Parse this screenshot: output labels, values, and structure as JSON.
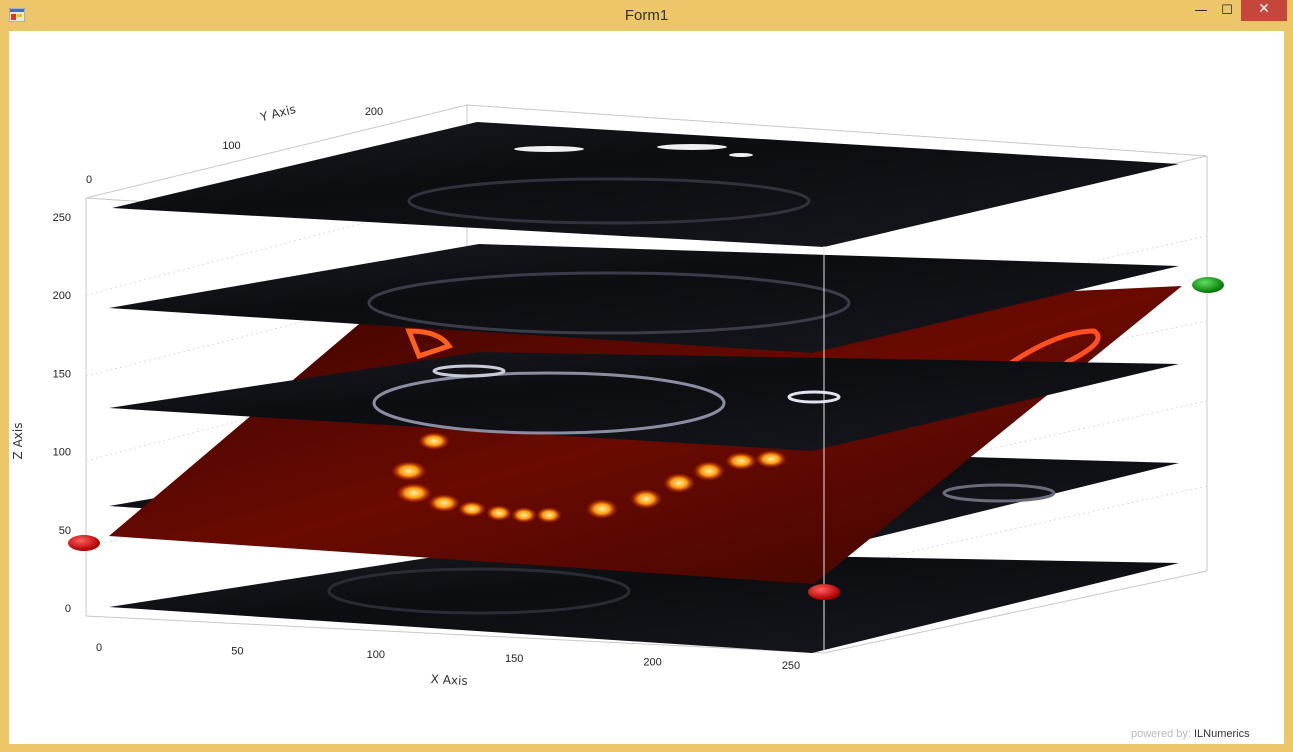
{
  "window": {
    "title": "Form1",
    "minimize_glyph": "—",
    "maximize_glyph": "☐",
    "close_glyph": "✕"
  },
  "chart_data": {
    "type": "3d-slice-volume",
    "xlabel": "X Axis",
    "ylabel": "Y Axis",
    "zlabel": "Z Axis",
    "xlim": [
      0,
      256
    ],
    "ylim": [
      0,
      256
    ],
    "zlim": [
      0,
      256
    ],
    "x_ticks": [
      "0",
      "50",
      "100",
      "150",
      "200",
      "250"
    ],
    "y_ticks": [
      "0",
      "100",
      "200"
    ],
    "z_ticks": [
      "0",
      "50",
      "100",
      "150",
      "200",
      "250"
    ],
    "grayscale_slices_z": [
      0,
      55,
      120,
      190,
      255
    ],
    "heatmap_slice": "tilted",
    "handles": [
      {
        "name": "handle-red-left",
        "color": "#d81010"
      },
      {
        "name": "handle-red-front",
        "color": "#d81010"
      },
      {
        "name": "handle-green-right",
        "color": "#1a9a1a"
      }
    ]
  },
  "footer": {
    "powered_by": "powered by:",
    "brand": "ILNumerics"
  }
}
